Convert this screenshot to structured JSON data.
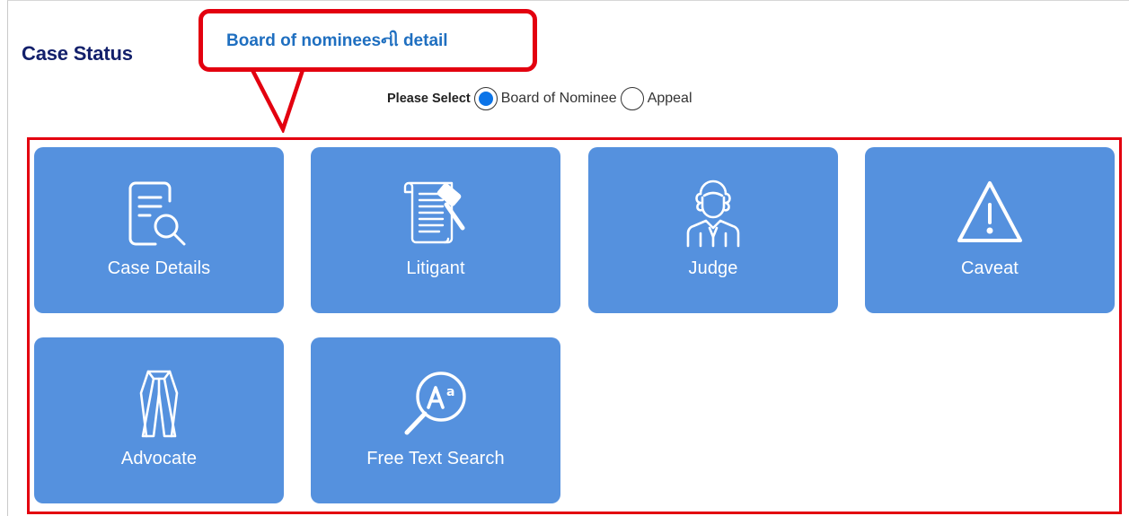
{
  "header": {
    "title": "Case Status"
  },
  "callout": {
    "text": "Board of nomineesની detail"
  },
  "selector": {
    "label": "Please Select",
    "options": [
      {
        "label": "Board of Nominee",
        "selected": true
      },
      {
        "label": "Appeal",
        "selected": false
      }
    ]
  },
  "tiles": [
    {
      "label": "Case Details",
      "icon": "document-search-icon"
    },
    {
      "label": "Litigant",
      "icon": "scroll-gavel-icon"
    },
    {
      "label": "Judge",
      "icon": "judge-icon"
    },
    {
      "label": "Caveat",
      "icon": "warning-icon"
    },
    {
      "label": "Advocate",
      "icon": "advocate-gown-icon"
    },
    {
      "label": "Free Text Search",
      "icon": "text-search-icon"
    }
  ],
  "colors": {
    "tile": "#5591de",
    "title": "#13206b",
    "highlight": "#e3000f",
    "callout_text": "#1f6fc0",
    "radio_selected": "#0b74e8"
  }
}
